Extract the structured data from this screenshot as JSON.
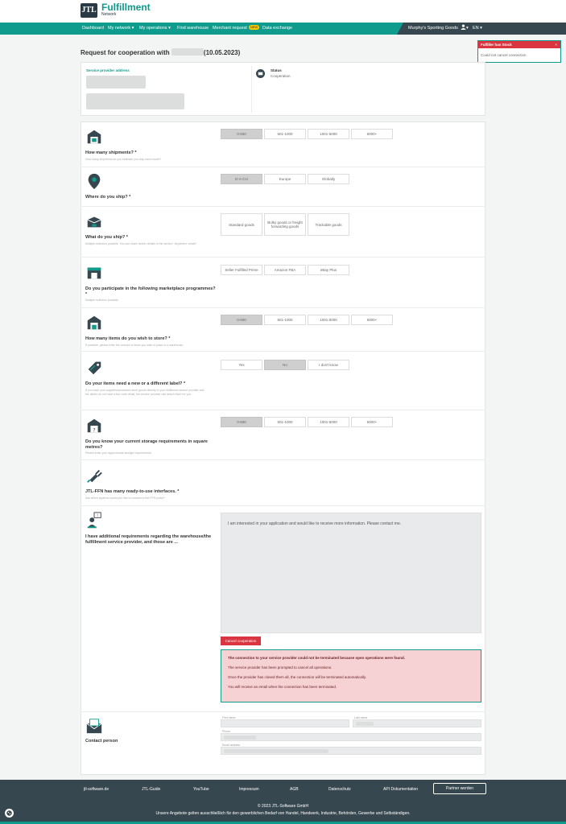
{
  "header": {
    "logo_text": "JTL",
    "brand": "Fulfillment",
    "brand_sub": "Network"
  },
  "nav": {
    "items": [
      "Dashboard",
      "My network ▾",
      "My operations ▾",
      "Find warehouse",
      "Merchant request",
      "Data exchange"
    ],
    "badge": "NEW",
    "company": "Murphy's Sporting Goods",
    "user_caret": "▾",
    "lang": "EN ▾"
  },
  "toast": {
    "title": "Fulfiller has Stock",
    "body": "Could not cancel connection",
    "close": "×"
  },
  "page": {
    "title_prefix": "Request for cooperation with",
    "title_suffix": "(10.05.2023)"
  },
  "provider": {
    "address_label": "Service provider address",
    "status_label": "Status",
    "status_value": "Cooperation"
  },
  "questions": [
    {
      "title": "How many shipments? *",
      "sub": "How many shipments do you estimate you ship each month?",
      "options": [
        "0-500",
        "501-1000",
        "1001-5000",
        "5000+"
      ],
      "selected": 0
    },
    {
      "title": "Where do you ship? *",
      "sub": "",
      "options": [
        "D-A-CH",
        "Europe",
        "Globally"
      ],
      "selected": 0
    },
    {
      "title": "What do you ship? *",
      "sub": "Multiple selection possible. You can share further details in the section \"Anywhere create\".",
      "options": [
        "Standard goods",
        "Bulky goods or freight forwarding goods",
        "Trackable goods"
      ],
      "selected": -1
    },
    {
      "title": "Do you participate in the following marketplace programmes? *",
      "sub": "Multiple selection possible.",
      "options": [
        "Seller Fulfilled Prime",
        "Amazon FBA",
        "eBay Plus"
      ],
      "selected": -1
    },
    {
      "title": "How many items do you wish to store? *",
      "sub": "If possible, please enter the amount of items you wish to place in a warehouse.",
      "options": [
        "0-500",
        "501-1000",
        "1001-5000",
        "5000+"
      ],
      "selected": 0
    },
    {
      "title": "Do your items need a new or a different label? *",
      "sub": "If you have your suppliers/producers send goods directly to your fulfillment service provider and the labels do not have a bar code detail, the service provider can attach them for you.",
      "options": [
        "Yes",
        "No",
        "I don't know"
      ],
      "selected": 1
    },
    {
      "title": "Do you know your current storage requirements in square metres?",
      "sub": "Please enter your approximate storage requirements.",
      "options": [
        "0-500",
        "501-1000",
        "1001-5000",
        "5000+"
      ],
      "selected": 0
    },
    {
      "title": "JTL-FFN has many ready-to-use interfaces. *",
      "sub": "Ask which systems would you like to connect to the FFN portal?",
      "options": [],
      "selected": -1
    },
    {
      "title": "I have additional requirements regarding the warehouse/the fulfillment service provider, and those are ...",
      "sub": "",
      "options": [],
      "selected": -1
    }
  ],
  "message": {
    "text": "I am interested in your application and would like to receive more information. Please contact me."
  },
  "cancel_button": "Cancel cooperation",
  "alert": {
    "title": "The connection to your service provider could not be terminated because open operations were found.",
    "lines": [
      "The service provider has been prompted to cancel all operations.",
      "Once the provider has closed them all, the connection will be terminated automatically.",
      "You will receive an email when the connection has been terminated."
    ]
  },
  "contact": {
    "title": "Contact person",
    "first_name": "First name",
    "last_name": "Last name",
    "phone": "Phone",
    "email": "Email address"
  },
  "footer": {
    "links": [
      "jtl-software.de",
      "JTL-Guide",
      "YouTube",
      "Impressum",
      "AGB",
      "Datenschutz",
      "API Dokumentation"
    ],
    "partner_button": "Partner werden",
    "copyright": "© 2023 JTL-Software GmbH",
    "disclaimer": "Unsere Angebote gelten ausschließlich für den gewerblichen Bedarf von Handel, Handwerk, Industrie, Behörden, Gewerbe und Selbständigen."
  },
  "colors": {
    "teal": "#0f9c8d",
    "dark": "#37474f",
    "red": "#d9343f"
  }
}
